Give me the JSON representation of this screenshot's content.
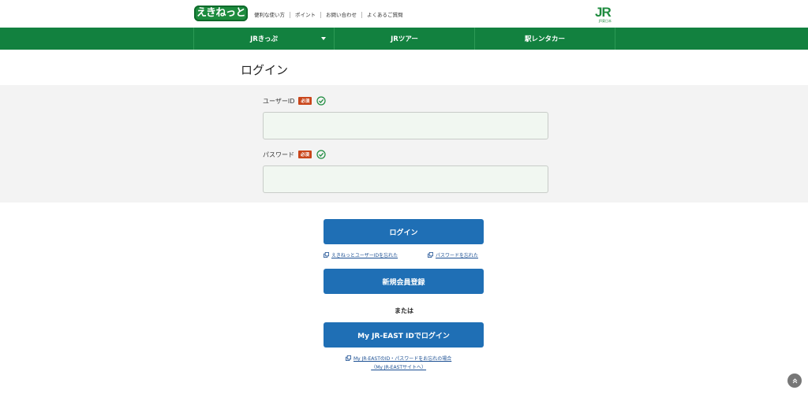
{
  "header": {
    "logo_text": "えきねっと",
    "util_links": [
      "便利な使い方",
      "ポイント",
      "お問い合わせ",
      "よくあるご質問"
    ],
    "jr_mark": "JR",
    "jr_sub": "JR東日本"
  },
  "nav": {
    "items": [
      "JRきっぷ",
      "JRツアー",
      "駅レンタカー"
    ]
  },
  "page": {
    "title": "ログイン"
  },
  "form": {
    "user_label": "ユーザーID",
    "password_label": "パスワード",
    "required_badge": "必須",
    "user_value": "",
    "password_value": ""
  },
  "actions": {
    "login_button": "ログイン",
    "forgot_user_link": "えきねっとユーザーIDを忘れた",
    "forgot_password_link": "パスワードを忘れた",
    "register_button": "新規会員登録",
    "or_text": "または",
    "myjr_button": "My JR-EAST IDでログイン",
    "myjr_link_line1": "My JR-EASTのID・パスワードをお忘れの場合",
    "myjr_link_line2": "（My JR-EASTサイトへ）"
  },
  "colors": {
    "brand_green": "#12813f",
    "button_blue": "#1f6fb5",
    "required_red": "#c9461b"
  },
  "icons": {
    "check": "check-circle-icon",
    "external": "external-link-icon",
    "scroll_top": "chevron-up-icon"
  }
}
